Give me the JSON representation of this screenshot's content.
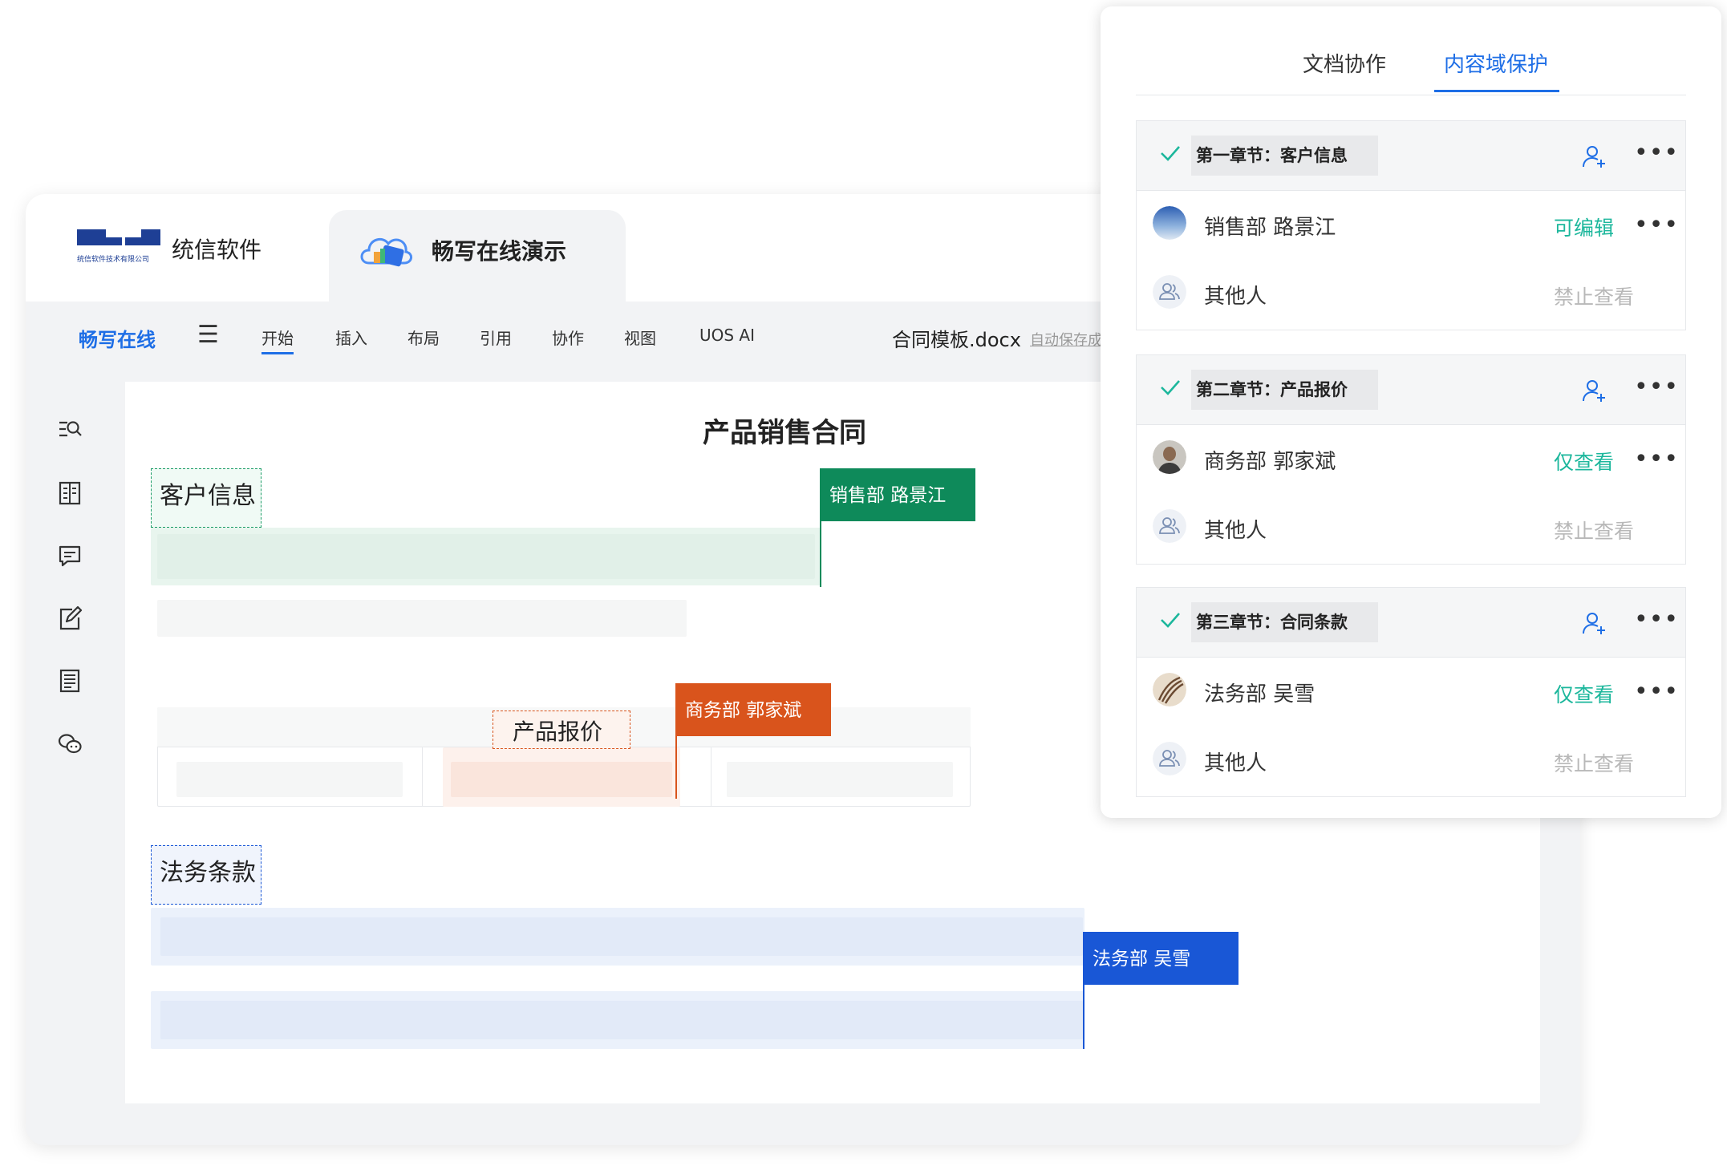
{
  "tabs": {
    "uniontech": {
      "label": "统信软件",
      "logo_sub": "统信软件技术有限公司"
    },
    "changxie": {
      "label": "畅写在线演示"
    }
  },
  "menu": {
    "brand": "畅写在线",
    "items": [
      "开始",
      "插入",
      "布局",
      "引用",
      "协作",
      "视图",
      "UOS AI"
    ],
    "active_index": 0,
    "doc_name": "合同模板.docx",
    "autosave": "自动保存成"
  },
  "tools": [
    "search-list-icon",
    "book-icon",
    "comment-icon",
    "edit-icon",
    "document-icon",
    "chat-icon"
  ],
  "document": {
    "title": "产品销售合同",
    "sections": [
      {
        "label": "客户信息",
        "owner": "销售部 路景江",
        "color": "#0e8a5a"
      },
      {
        "label": "产品报价",
        "owner": "商务部 郭家斌",
        "color": "#d9541c"
      },
      {
        "label": "法务条款",
        "owner": "法务部 吴雪",
        "color": "#1957d6"
      }
    ]
  },
  "panel": {
    "tabs": [
      "文档协作",
      "内容域保护"
    ],
    "active_tab": 1,
    "sections": [
      {
        "title": "第一章节：客户信息",
        "members": [
          {
            "name": "销售部 路景江",
            "permission": "可编辑",
            "kind": "edit",
            "avatar": "sky"
          },
          {
            "name": "其他人",
            "permission": "禁止查看",
            "kind": "deny",
            "avatar": "group"
          }
        ]
      },
      {
        "title": "第二章节：产品报价",
        "members": [
          {
            "name": "商务部 郭家斌",
            "permission": "仅查看",
            "kind": "view",
            "avatar": "person"
          },
          {
            "name": "其他人",
            "permission": "禁止查看",
            "kind": "deny",
            "avatar": "group"
          }
        ]
      },
      {
        "title": "第三章节：合同条款",
        "members": [
          {
            "name": "法务部 吴雪",
            "permission": "仅查看",
            "kind": "view",
            "avatar": "feather"
          },
          {
            "name": "其他人",
            "permission": "禁止查看",
            "kind": "deny",
            "avatar": "group"
          }
        ]
      }
    ],
    "accent": "#1e6ee6",
    "perm_color": "#1cb79c"
  }
}
